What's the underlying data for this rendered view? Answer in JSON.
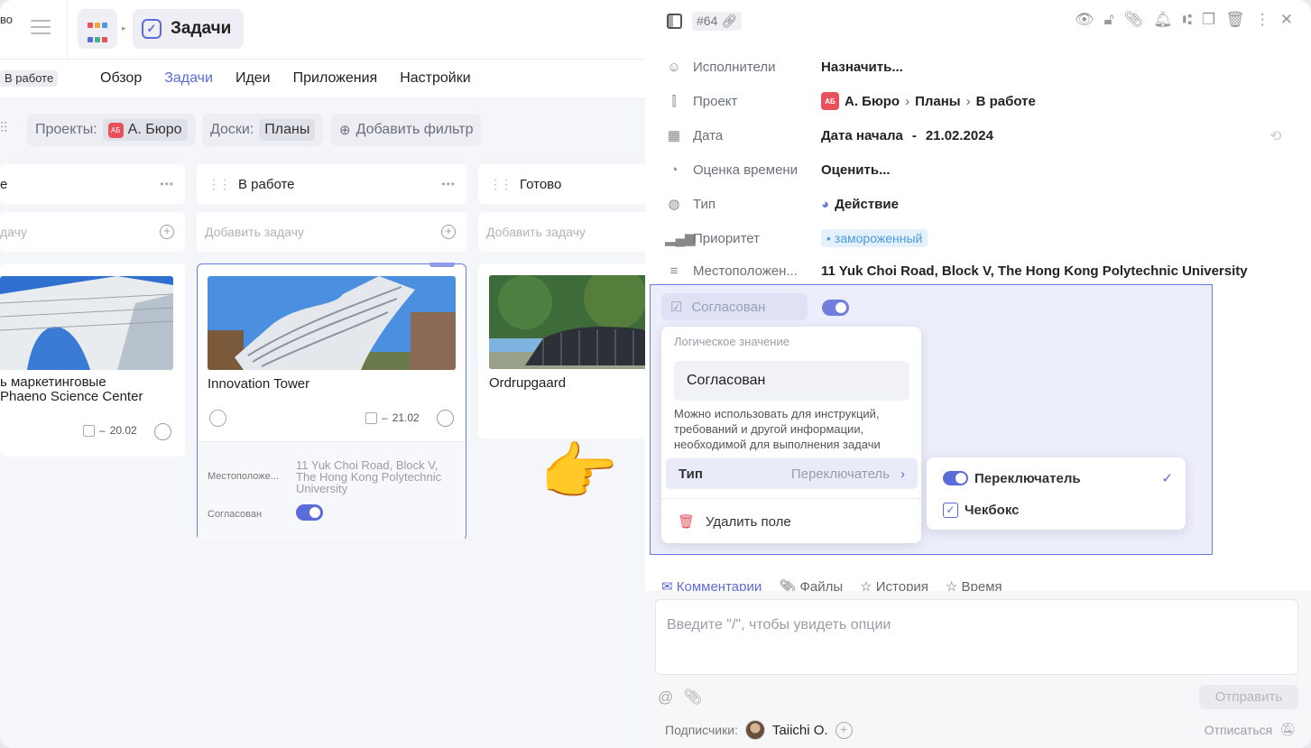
{
  "app": {
    "workspace_name": "во",
    "section_title": "Задачи",
    "status_chip": "В работе"
  },
  "nav": {
    "tabs": [
      {
        "label": "Обзор",
        "active": false
      },
      {
        "label": "Задачи",
        "active": true
      },
      {
        "label": "Идеи",
        "active": false
      },
      {
        "label": "Приложения",
        "active": false
      },
      {
        "label": "Настройки",
        "active": false
      }
    ]
  },
  "filters": {
    "projects_label": "Проекты:",
    "projects_value": "А. Бюро",
    "projects_badge": "АБ",
    "boards_label": "Доски:",
    "boards_value": "Планы",
    "add_filter": "Добавить фильтр"
  },
  "board": {
    "add_task_placeholder": "Добавить задачу",
    "columns": [
      {
        "title": "е",
        "add_placeholder": "дачу",
        "card": {
          "title_line1": "ь маркетинговые",
          "title_line2": "Phaeno Science Center",
          "date": "20.02"
        }
      },
      {
        "title": "В работе",
        "add_placeholder": "Добавить задачу",
        "card": {
          "title": "Innovation Tower",
          "date": "21.02",
          "location_label": "Местоположе...",
          "location_value": "11 Yuk Choi Road, Block V, The Hong Kong Polytechnic University",
          "approved_label": "Согласован",
          "approved": true
        }
      },
      {
        "title": "Готово",
        "add_placeholder": "Добавить задачу",
        "card": {
          "title": "Ordrupgaard"
        }
      }
    ]
  },
  "panel": {
    "task_id": "#64",
    "props": {
      "assignees": {
        "label": "Исполнители",
        "value": "Назначить..."
      },
      "project": {
        "label": "Проект",
        "badge": "АБ",
        "value": "А. Бюро",
        "board": "Планы",
        "status": "В работе"
      },
      "date": {
        "label": "Дата",
        "start": "Дата начала",
        "dash": "-",
        "end": "21.02.2024"
      },
      "estimate": {
        "label": "Оценка времени",
        "value": "Оценить..."
      },
      "type": {
        "label": "Тип",
        "value": "Действие"
      },
      "priority": {
        "label": "Приоритет",
        "value": "замороженный"
      },
      "location": {
        "label": "Местоположен...",
        "value": "11 Yuk Choi Road, Block V, The Hong Kong Polytechnic University"
      },
      "approved": {
        "label": "Согласован",
        "value": true
      }
    },
    "field_popup": {
      "caption": "Логическое значение",
      "name": "Согласован",
      "description": "Можно использовать для инструкций, требований и другой информации, необходимой для выполнения задачи",
      "type_label": "Тип",
      "type_value": "Переключатель",
      "delete_label": "Удалить поле"
    },
    "type_options": [
      {
        "label": "Переключатель",
        "selected": true
      },
      {
        "label": "Чекбокс",
        "selected": false
      }
    ],
    "tabs": [
      "Комментарии",
      "Файлы",
      "История",
      "Время"
    ],
    "comment_placeholder": "Введите \"/\", чтобы увидеть опции",
    "send_label": "Отправить",
    "subscribers_label": "Подписчики:",
    "subscriber_name": "Taiichi O.",
    "unsubscribe_label": "Отписаться"
  },
  "colors": {
    "accent": "#5b6bd8",
    "danger": "#e8505b",
    "priority_bg": "#e4f1fd",
    "priority_fg": "#4a9be0"
  }
}
